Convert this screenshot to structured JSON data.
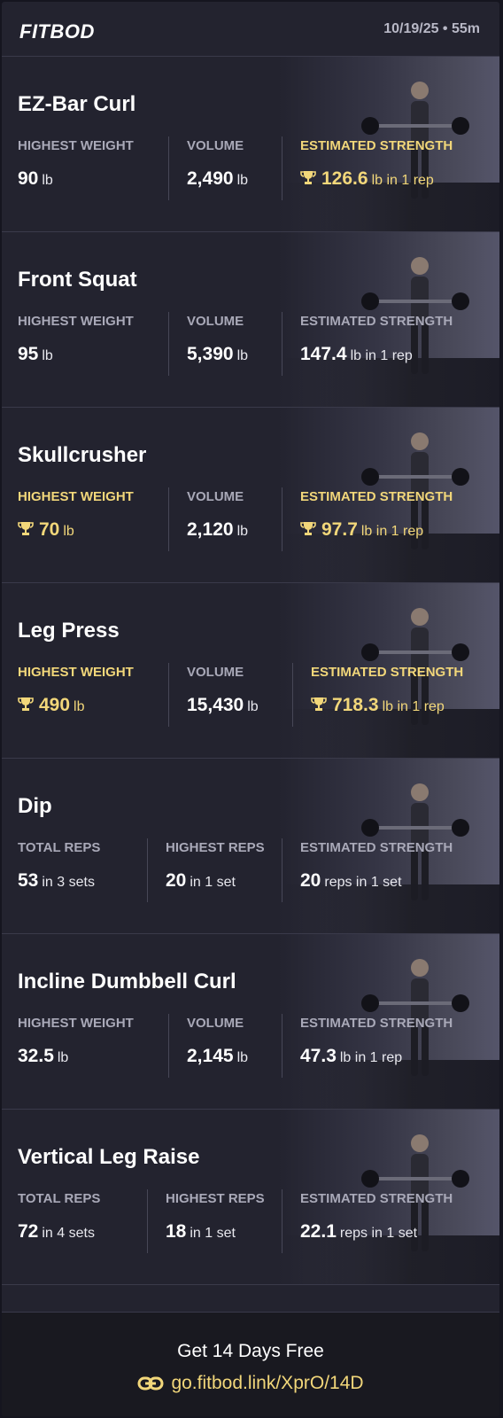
{
  "header": {
    "logo": "FITBOD",
    "meta": "10/19/25 • 55m"
  },
  "colors": {
    "accent": "#f2d77a",
    "background": "#23232f",
    "label": "#a9a9b8"
  },
  "exercises": [
    {
      "title": "EZ-Bar Curl",
      "stats": [
        {
          "label": "HIGHEST WEIGHT",
          "value": "90",
          "unit": "lb",
          "highlight": false
        },
        {
          "label": "VOLUME",
          "value": "2,490",
          "unit": "lb",
          "highlight": false
        },
        {
          "label": "ESTIMATED STRENGTH",
          "value": "126.6",
          "unit": "lb in 1 rep",
          "highlight": true
        }
      ]
    },
    {
      "title": "Front Squat",
      "stats": [
        {
          "label": "HIGHEST WEIGHT",
          "value": "95",
          "unit": "lb",
          "highlight": false
        },
        {
          "label": "VOLUME",
          "value": "5,390",
          "unit": "lb",
          "highlight": false
        },
        {
          "label": "ESTIMATED STRENGTH",
          "value": "147.4",
          "unit": "lb in 1 rep",
          "highlight": false
        }
      ]
    },
    {
      "title": "Skullcrusher",
      "stats": [
        {
          "label": "HIGHEST WEIGHT",
          "value": "70",
          "unit": "lb",
          "highlight": true
        },
        {
          "label": "VOLUME",
          "value": "2,120",
          "unit": "lb",
          "highlight": false
        },
        {
          "label": "ESTIMATED STRENGTH",
          "value": "97.7",
          "unit": "lb in 1 rep",
          "highlight": true
        }
      ]
    },
    {
      "title": "Leg Press",
      "stats": [
        {
          "label": "HIGHEST WEIGHT",
          "value": "490",
          "unit": "lb",
          "highlight": true
        },
        {
          "label": "VOLUME",
          "value": "15,430",
          "unit": "lb",
          "highlight": false
        },
        {
          "label": "ESTIMATED STRENGTH",
          "value": "718.3",
          "unit": "lb in 1 rep",
          "highlight": true
        }
      ]
    },
    {
      "title": "Dip",
      "stats": [
        {
          "label": "TOTAL REPS",
          "value": "53",
          "unit": "in 3 sets",
          "highlight": false
        },
        {
          "label": "HIGHEST REPS",
          "value": "20",
          "unit": "in 1 set",
          "highlight": false
        },
        {
          "label": "ESTIMATED STRENGTH",
          "value": "20",
          "unit": "reps in 1 set",
          "highlight": false
        }
      ]
    },
    {
      "title": "Incline Dumbbell Curl",
      "stats": [
        {
          "label": "HIGHEST WEIGHT",
          "value": "32.5",
          "unit": "lb",
          "highlight": false
        },
        {
          "label": "VOLUME",
          "value": "2,145",
          "unit": "lb",
          "highlight": false
        },
        {
          "label": "ESTIMATED STRENGTH",
          "value": "47.3",
          "unit": "lb in 1 rep",
          "highlight": false
        }
      ]
    },
    {
      "title": "Vertical Leg Raise",
      "stats": [
        {
          "label": "TOTAL REPS",
          "value": "72",
          "unit": "in 4 sets",
          "highlight": false
        },
        {
          "label": "HIGHEST REPS",
          "value": "18",
          "unit": "in 1 set",
          "highlight": false
        },
        {
          "label": "ESTIMATED STRENGTH",
          "value": "22.1",
          "unit": "reps in 1 set",
          "highlight": false
        }
      ]
    }
  ],
  "footer": {
    "cta": "Get 14 Days Free",
    "link": "go.fitbod.link/XprO/14D",
    "link_icon": "link-icon"
  }
}
